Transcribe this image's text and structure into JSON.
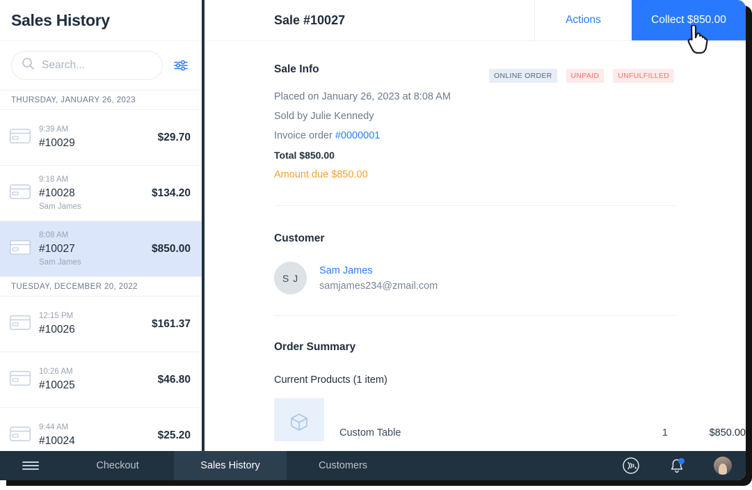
{
  "sidebar": {
    "title": "Sales History",
    "search": {
      "placeholder": "Search...",
      "value": ""
    },
    "filter_icon": "sliders-filter-icon",
    "groups": [
      {
        "date_label": "THURSDAY, JANUARY 26, 2023",
        "rows": [
          {
            "time": "9:39 AM",
            "id": "#10029",
            "customer": "",
            "amount": "$29.70",
            "icon": "credit-card-icon",
            "selected": false
          },
          {
            "time": "9:18 AM",
            "id": "#10028",
            "customer": "Sam James",
            "amount": "$134.20",
            "icon": "credit-card-icon",
            "selected": false
          },
          {
            "time": "8:08 AM",
            "id": "#10027",
            "customer": "Sam James",
            "amount": "$850.00",
            "icon": "credit-card-icon",
            "selected": true
          }
        ]
      },
      {
        "date_label": "TUESDAY, DECEMBER 20, 2022",
        "rows": [
          {
            "time": "12:15 PM",
            "id": "#10026",
            "customer": "",
            "amount": "$161.37",
            "icon": "credit-card-icon",
            "selected": false
          },
          {
            "time": "10:26 AM",
            "id": "#10025",
            "customer": "",
            "amount": "$46.80",
            "icon": "credit-card-icon",
            "selected": false
          },
          {
            "time": "9:44 AM",
            "id": "#10024",
            "customer": "",
            "amount": "$25.20",
            "icon": "credit-card-icon",
            "selected": false
          }
        ]
      }
    ]
  },
  "detail": {
    "title": "Sale #10027",
    "actions_label": "Actions",
    "collect_label": "Collect $850.00",
    "sale_info": {
      "heading": "Sale Info",
      "placed_on": "Placed on January 26, 2023 at 8:08 AM",
      "sold_by": "Sold by Julie Kennedy",
      "invoice_prefix": "Invoice order ",
      "invoice_number": "#0000001",
      "total": "Total $850.00",
      "amount_due": "Amount due $850.00",
      "badges": [
        {
          "label": "ONLINE ORDER",
          "style": "blue"
        },
        {
          "label": "UNPAID",
          "style": "pink"
        },
        {
          "label": "UNFULFILLED",
          "style": "pink"
        }
      ]
    },
    "customer": {
      "heading": "Customer",
      "initials": "S J",
      "name": "Sam James",
      "email": "samjames234@zmail.com"
    },
    "order_summary": {
      "heading": "Order Summary",
      "current_products_label": "Current Products (1 item)",
      "items": [
        {
          "name": "Custom Table",
          "qty": "1",
          "price": "$850.00",
          "icon": "box-product-icon"
        }
      ]
    }
  },
  "bottom_nav": {
    "menu_icon": "hamburger-menu-icon",
    "tabs": [
      {
        "label": "Checkout",
        "active": false
      },
      {
        "label": "Sales History",
        "active": true
      },
      {
        "label": "Customers",
        "active": false
      }
    ],
    "icons": [
      {
        "name": "contactless-payment-icon",
        "badge": false
      },
      {
        "name": "bell-notification-icon",
        "badge": true
      },
      {
        "name": "user-avatar",
        "badge": false
      }
    ]
  },
  "colors": {
    "accent_blue": "#2979ff",
    "nav_dark": "#20313f",
    "selected_row": "#dce6fb",
    "amount_due_orange": "#f5a030",
    "badge_pink_text": "#fa7268"
  },
  "cursor": {
    "type": "pointer-hand-cursor"
  }
}
